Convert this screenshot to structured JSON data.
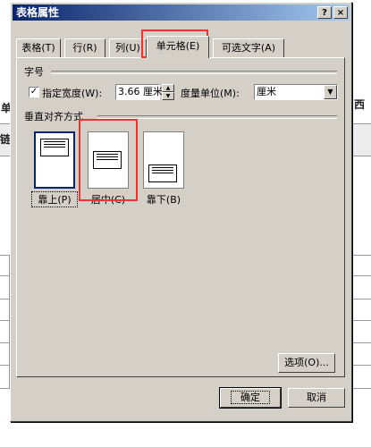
{
  "background": {
    "fragments": [
      "单",
      "西",
      "链"
    ]
  },
  "dialog": {
    "title": "表格属性",
    "help_button": "?",
    "close_button": "×",
    "tabs": [
      {
        "label": "表格(T)"
      },
      {
        "label": "行(R)"
      },
      {
        "label": "列(U)"
      },
      {
        "label": "单元格(E)"
      },
      {
        "label": "可选文字(A)"
      }
    ],
    "active_tab": "单元格(E)",
    "size_group": {
      "label": "字号",
      "checkbox_checked": "✓",
      "specify_width_label": "指定宽度(W):",
      "width_value": "3.66 厘米",
      "unit_label": "度量单位(M):",
      "unit_value": "厘米"
    },
    "valign_group": {
      "label": "垂直对齐方式",
      "options": [
        {
          "label": "靠上(P)"
        },
        {
          "label": "居中(C)"
        },
        {
          "label": "靠下(B)"
        }
      ],
      "selected": "靠上(P)"
    },
    "options_button": "选项(O)...",
    "ok_button": "确定",
    "cancel_button": "取消"
  },
  "colors": {
    "dialog_face": "#d4d0c8",
    "title_start": "#0a246a",
    "title_end": "#a6caf0",
    "highlight": "#e33333"
  }
}
